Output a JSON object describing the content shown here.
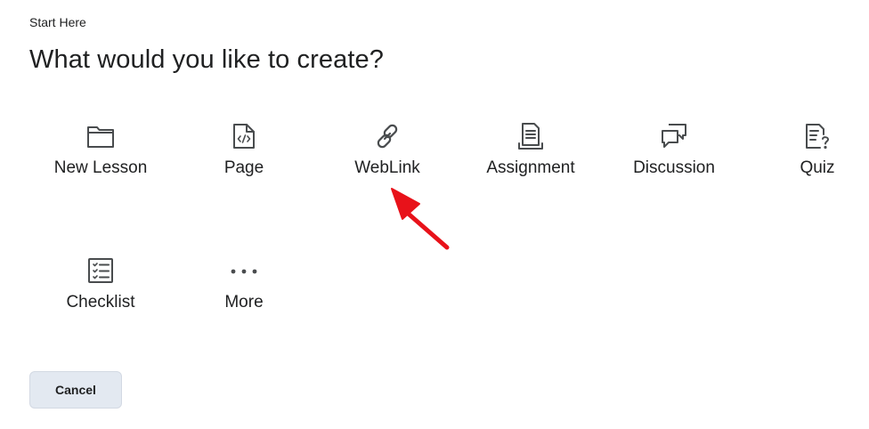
{
  "header": {
    "breadcrumb": "Start Here",
    "title": "What would you like to create?"
  },
  "options": {
    "new_lesson": {
      "label": "New Lesson",
      "icon": "folder-icon"
    },
    "page": {
      "label": "Page",
      "icon": "code-file-icon"
    },
    "weblink": {
      "label": "WebLink",
      "icon": "link-icon"
    },
    "assignment": {
      "label": "Assignment",
      "icon": "assignment-document-icon"
    },
    "discussion": {
      "label": "Discussion",
      "icon": "discussion-bubbles-icon"
    },
    "quiz": {
      "label": "Quiz",
      "icon": "quiz-icon"
    },
    "checklist": {
      "label": "Checklist",
      "icon": "checklist-icon"
    },
    "more": {
      "label": "More",
      "icon": "more-dots-icon"
    }
  },
  "actions": {
    "cancel_label": "Cancel"
  },
  "colors": {
    "text": "#202122",
    "icon_stroke": "#494c4e",
    "cancel_bg": "#e3e9f1",
    "annotation_arrow": "#e8121a"
  }
}
